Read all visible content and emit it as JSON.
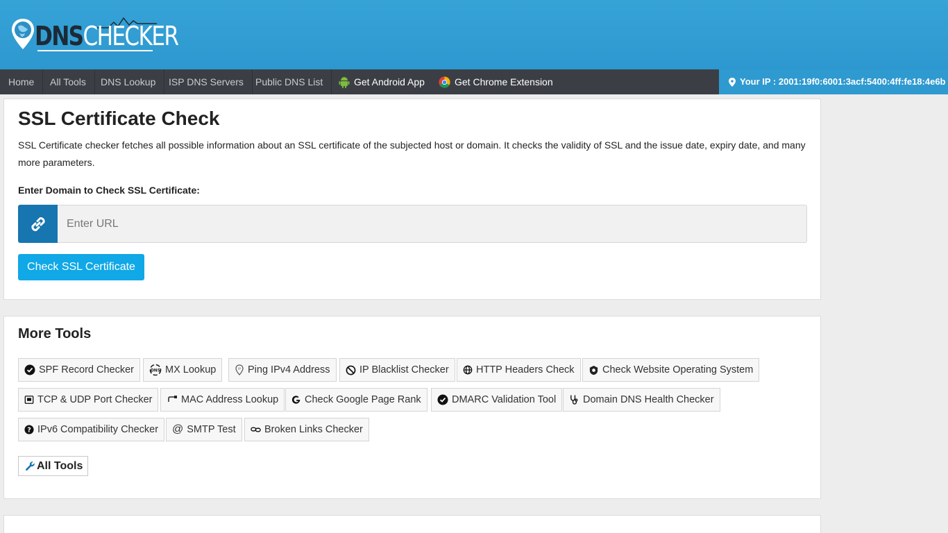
{
  "brand": {
    "logo_prefix": "DNS",
    "logo_suffix": "CHECKER"
  },
  "nav": {
    "items": [
      "Home",
      "All Tools",
      "DNS Lookup",
      "ISP DNS Servers",
      "Public DNS List"
    ],
    "android_label": "Get Android App",
    "chrome_label": "Get Chrome Extension",
    "ip_text": "Your IP : 2001:19f0:6001:3acf:5400:4ff:fe18:4e6b"
  },
  "main": {
    "title": "SSL Certificate Check",
    "description": "SSL Certificate checker fetches all possible information about an SSL certificate of the subjected host or domain. It checks the validity of SSL and the issue date, expiry date, and many more parameters.",
    "field_label": "Enter Domain to Check SSL Certificate:",
    "input_placeholder": "Enter URL",
    "input_value": "",
    "submit_label": "Check SSL Certificate"
  },
  "more_tools": {
    "title": "More Tools",
    "tools": [
      {
        "label": "SPF Record Checker",
        "icon": "check-badge-icon"
      },
      {
        "label": "MX Lookup",
        "icon": "dns-icon"
      },
      {
        "label": "Ping IPv4 Address",
        "icon": "ping-pin-icon"
      },
      {
        "label": "IP Blacklist Checker",
        "icon": "ban-icon"
      },
      {
        "label": "HTTP Headers Check",
        "icon": "globe-icon"
      },
      {
        "label": "Check Website Operating System",
        "icon": "os-icon"
      },
      {
        "label": "TCP & UDP Port Checker",
        "icon": "port-icon"
      },
      {
        "label": "MAC Address Lookup",
        "icon": "mac-icon"
      },
      {
        "label": "Check Google Page Rank",
        "icon": "google-icon"
      },
      {
        "label": "DMARC Validation Tool",
        "icon": "check-badge-icon"
      },
      {
        "label": "Domain DNS Health Checker",
        "icon": "stethoscope-icon"
      },
      {
        "label": "IPv6 Compatibility Checker",
        "icon": "question-icon"
      },
      {
        "label": "SMTP Test",
        "icon": "at-icon"
      },
      {
        "label": "Broken Links Checker",
        "icon": "broken-link-icon"
      }
    ],
    "all_tools_label": "All Tools"
  },
  "colors": {
    "header": "#36a3d7",
    "nav": "#3b3f45",
    "ip_bar": "#2f9ad0",
    "addon": "#1775b0",
    "button": "#10a8e6"
  }
}
